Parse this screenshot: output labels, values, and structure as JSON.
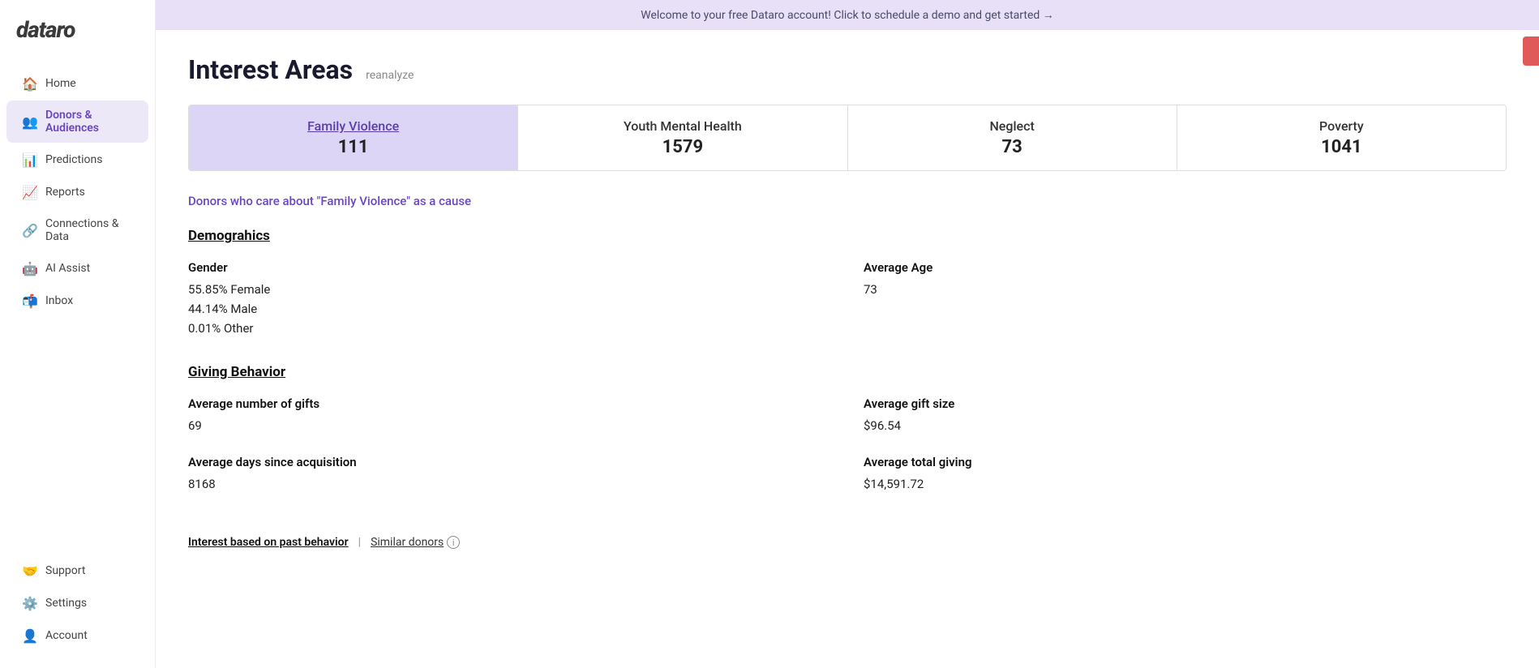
{
  "banner": {
    "text": "Welcome to your free Dataro account! Click to schedule a demo and get started →"
  },
  "logo": {
    "text": "dataro"
  },
  "sidebar": {
    "items": [
      {
        "id": "home",
        "label": "Home",
        "icon": "🏠",
        "active": false
      },
      {
        "id": "donors",
        "label": "Donors & Audiences",
        "icon": "👥",
        "active": true
      },
      {
        "id": "predictions",
        "label": "Predictions",
        "icon": "📊",
        "active": false
      },
      {
        "id": "reports",
        "label": "Reports",
        "icon": "📈",
        "active": false
      },
      {
        "id": "connections",
        "label": "Connections & Data",
        "icon": "🔗",
        "active": false
      },
      {
        "id": "ai-assist",
        "label": "AI Assist",
        "icon": "🤖",
        "active": false
      },
      {
        "id": "inbox",
        "label": "Inbox",
        "icon": "📬",
        "active": false
      },
      {
        "id": "support",
        "label": "Support",
        "icon": "🤝",
        "active": false
      },
      {
        "id": "settings",
        "label": "Settings",
        "icon": "⚙️",
        "active": false
      },
      {
        "id": "account",
        "label": "Account",
        "icon": "👤",
        "active": false
      }
    ]
  },
  "page": {
    "title": "Interest Areas",
    "reanalyze": "reanalyze",
    "active_tab_link": "Donors who care about \"Family Violence\" as a cause",
    "tabs": [
      {
        "id": "family-violence",
        "name": "Family Violence",
        "count": "111",
        "active": true
      },
      {
        "id": "youth-mental-health",
        "name": "Youth Mental Health",
        "count": "1579",
        "active": false
      },
      {
        "id": "neglect",
        "name": "Neglect",
        "count": "73",
        "active": false
      },
      {
        "id": "poverty",
        "name": "Poverty",
        "count": "1041",
        "active": false
      }
    ],
    "demographics": {
      "title": "Demograhics",
      "gender_label": "Gender",
      "gender_values": "55.85% Female\n44.14% Male\n0.01% Other",
      "avg_age_label": "Average Age",
      "avg_age_value": "73"
    },
    "giving_behavior": {
      "title": "Giving Behavior",
      "avg_gifts_label": "Average number of gifts",
      "avg_gifts_value": "69",
      "avg_gift_size_label": "Average gift size",
      "avg_gift_size_value": "$96.54",
      "avg_days_label": "Average days since acquisition",
      "avg_days_value": "8168",
      "avg_total_label": "Average total giving",
      "avg_total_value": "$14,591.72"
    },
    "bottom_tabs": [
      {
        "id": "interest-based",
        "label": "Interest based on past behavior",
        "active": true
      },
      {
        "id": "similar-donors",
        "label": "Similar donors",
        "active": false,
        "has_info": true
      }
    ]
  }
}
